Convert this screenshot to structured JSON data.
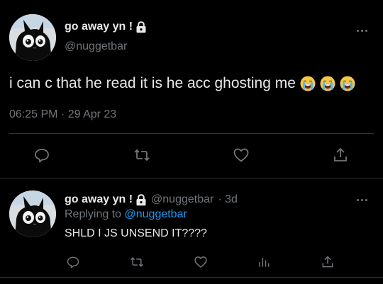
{
  "main_tweet": {
    "display_name": "go away yn !",
    "handle": "@nuggetbar",
    "text": "i can c that he read it is he acc ghosting me",
    "emojis": [
      "loudly-crying-face",
      "loudly-crying-face",
      "loudly-crying-face"
    ],
    "timestamp": "06:25 PM · 29 Apr 23",
    "actions": [
      "reply-icon",
      "retweet-icon",
      "like-icon",
      "share-icon"
    ]
  },
  "reply_tweet": {
    "display_name": "go away yn !",
    "handle": "@nuggetbar",
    "time": "· 3d",
    "replying_prefix": "Replying to",
    "replying_to": "@nuggetbar",
    "text": "SHLD I JS UNSEND IT????",
    "actions": [
      "reply-icon",
      "retweet-icon",
      "like-icon",
      "analytics-icon",
      "share-icon"
    ]
  },
  "colors": {
    "background": "#000000",
    "primary_text": "#e7e9ea",
    "secondary_text": "#71767b",
    "link": "#1d9bf0",
    "divider": "#2f3336"
  }
}
